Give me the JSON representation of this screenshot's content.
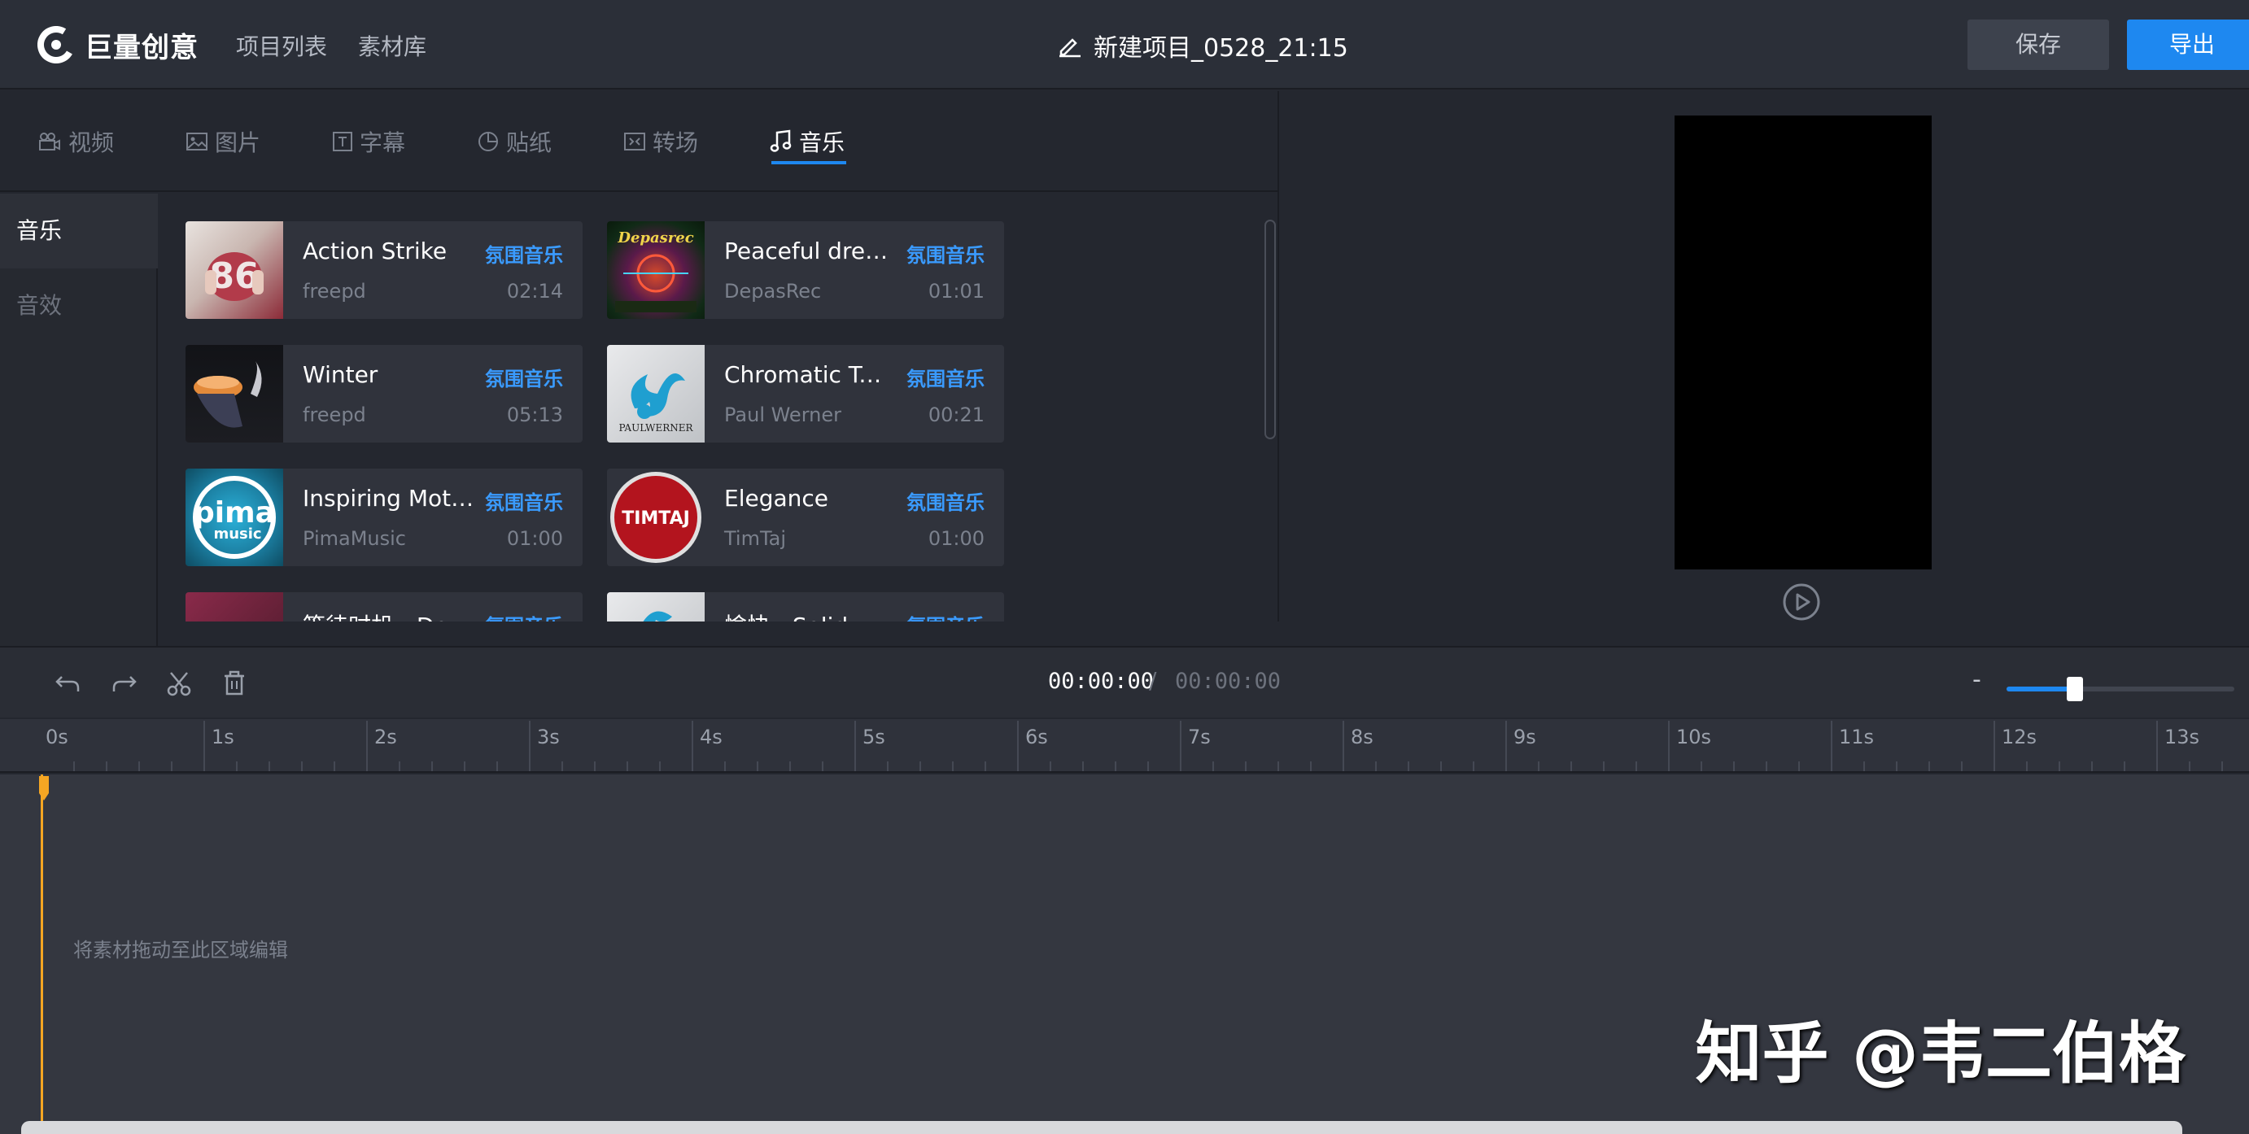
{
  "header": {
    "logo_text": "巨量创意",
    "nav_projects": "项目列表",
    "nav_library": "素材库",
    "project_title": "新建项目_0528_21:15",
    "save_label": "保存",
    "export_label": "导出"
  },
  "tabs": [
    {
      "label": "视频",
      "icon": "video-icon"
    },
    {
      "label": "图片",
      "icon": "image-icon"
    },
    {
      "label": "字幕",
      "icon": "text-icon"
    },
    {
      "label": "贴纸",
      "icon": "sticker-icon"
    },
    {
      "label": "转场",
      "icon": "transition-icon"
    },
    {
      "label": "音乐",
      "icon": "music-note-icon",
      "active": true
    }
  ],
  "categories": [
    {
      "label": "音乐",
      "active": true
    },
    {
      "label": "音效"
    }
  ],
  "music": [
    {
      "title": "Action Strike",
      "tag": "氛围音乐",
      "author": "freepd",
      "duration": "02:14"
    },
    {
      "title": "Peaceful drea...",
      "tag": "氛围音乐",
      "author": "DepasRec",
      "duration": "01:01",
      "thumb_text": "Depasrec"
    },
    {
      "title": "Winter",
      "tag": "氛围音乐",
      "author": "freepd",
      "duration": "05:13"
    },
    {
      "title": "Chromatic Twist",
      "tag": "氛围音乐",
      "author": "Paul Werner",
      "duration": "00:21",
      "thumb_text": "PAULWERNER"
    },
    {
      "title": "Inspiring Motiv...",
      "tag": "氛围音乐",
      "author": "PimaMusic",
      "duration": "01:00",
      "thumb_text": "pima"
    },
    {
      "title": "Elegance",
      "tag": "氛围音乐",
      "author": "TimTaj",
      "duration": "01:00",
      "thumb_text": "TIMTAJ"
    },
    {
      "title": "等待时机 - De",
      "tag": "氛围音乐",
      "author": "",
      "duration": ""
    },
    {
      "title": "愉快 - Solid",
      "tag": "氛围音乐",
      "author": "",
      "duration": ""
    }
  ],
  "timeline": {
    "current_time": "00:00:00",
    "separator": "/",
    "total_time": "00:00:00",
    "zoom_minus": "-",
    "zoom_level": 0.3,
    "ticks": [
      "0s",
      "1s",
      "2s",
      "3s",
      "4s",
      "5s",
      "6s",
      "7s",
      "8s",
      "9s",
      "10s",
      "11s",
      "12s",
      "13s"
    ],
    "drop_hint": "将素材拖动至此区域编辑"
  },
  "watermark": "知乎 @韦二伯格",
  "colors": {
    "accent": "#1e88f0",
    "tag": "#3a9bff",
    "playhead": "#f5a623"
  }
}
